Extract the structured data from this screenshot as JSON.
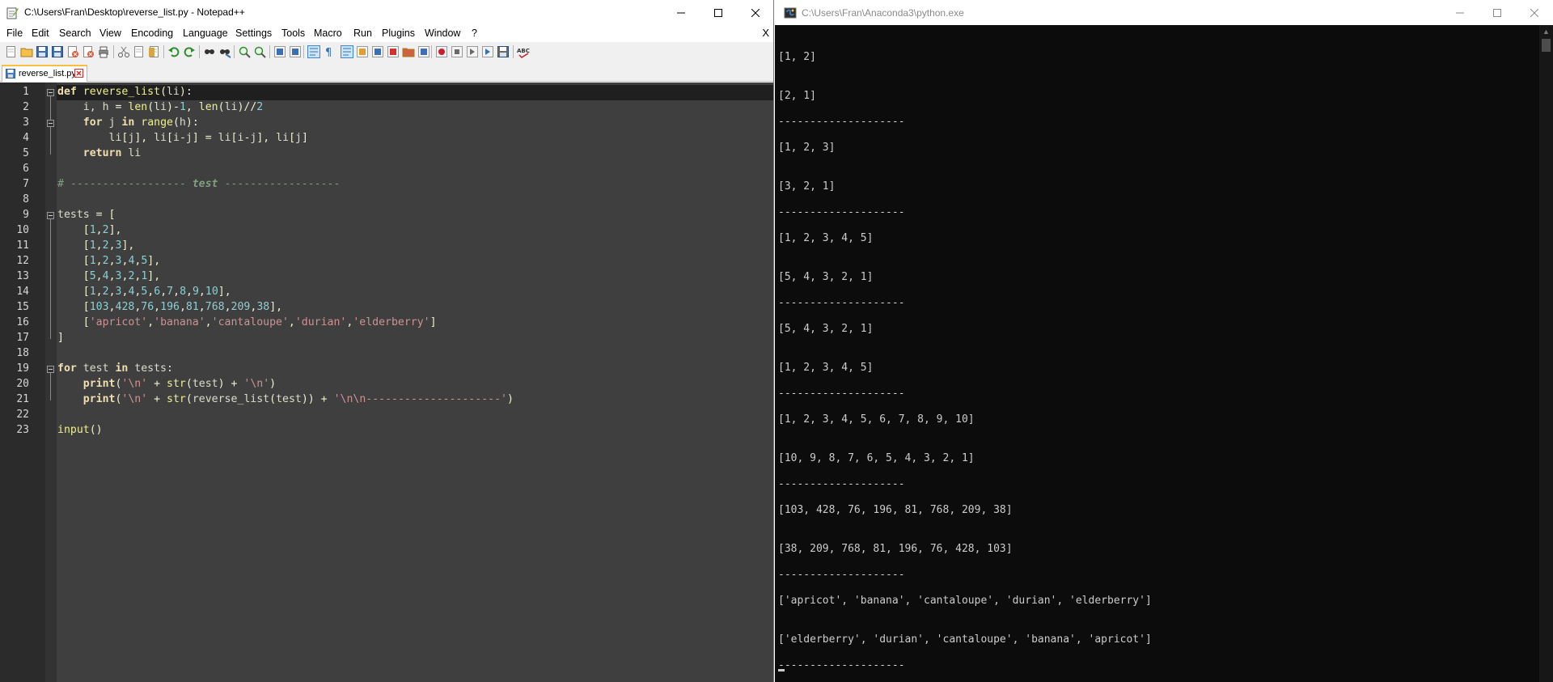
{
  "notepad": {
    "title": "C:\\Users\\Fran\\Desktop\\reverse_list.py - Notepad++",
    "menu": [
      "File",
      "Edit",
      "Search",
      "View",
      "Encoding",
      "Language",
      "Settings",
      "Tools",
      "Macro",
      "Run",
      "Plugins",
      "Window",
      "?"
    ],
    "doc_close_label": "X",
    "tab_label": "reverse_list.py",
    "line_numbers": [
      "1",
      "2",
      "3",
      "4",
      "5",
      "6",
      "7",
      "8",
      "9",
      "10",
      "11",
      "12",
      "13",
      "14",
      "15",
      "16",
      "17",
      "18",
      "19",
      "20",
      "21",
      "22",
      "23"
    ],
    "toolbar_icons": [
      "new-file-icon",
      "open-icon",
      "save-icon",
      "save-all-icon",
      "close-icon",
      "close-all-icon",
      "print-icon",
      "cut-icon",
      "copy-icon",
      "paste-icon",
      "undo-icon",
      "redo-icon",
      "find-icon",
      "replace-icon",
      "zoom-in-icon",
      "zoom-out-icon",
      "sync-vertical-icon",
      "sync-horizontal-icon",
      "word-wrap-icon",
      "show-all-chars-icon",
      "indent-guide-icon",
      "user-lang-icon",
      "doc-map-icon",
      "function-list-icon",
      "folder-workspace-icon",
      "monitoring-icon",
      "record-macro-icon",
      "stop-macro-icon",
      "play-macro-icon",
      "run-macro-multiple-icon",
      "save-macro-icon",
      "spell-check-icon"
    ]
  },
  "code": [
    [
      [
        "k",
        "def"
      ],
      [
        "p",
        " "
      ],
      [
        "f",
        "reverse_list"
      ],
      [
        "o",
        "("
      ],
      [
        "p",
        "li"
      ],
      [
        "o",
        "):"
      ]
    ],
    [
      [
        "p",
        "    i, h "
      ],
      [
        "o",
        "="
      ],
      [
        "p",
        " "
      ],
      [
        "f",
        "len"
      ],
      [
        "o",
        "("
      ],
      [
        "p",
        "li"
      ],
      [
        "o",
        ")-"
      ],
      [
        "n",
        "1"
      ],
      [
        "o",
        ","
      ],
      [
        "p",
        " "
      ],
      [
        "f",
        "len"
      ],
      [
        "o",
        "("
      ],
      [
        "p",
        "li"
      ],
      [
        "o",
        ")//"
      ],
      [
        "n",
        "2"
      ]
    ],
    [
      [
        "p",
        "    "
      ],
      [
        "k",
        "for"
      ],
      [
        "p",
        " j "
      ],
      [
        "k",
        "in"
      ],
      [
        "p",
        " "
      ],
      [
        "f",
        "range"
      ],
      [
        "o",
        "("
      ],
      [
        "p",
        "h"
      ],
      [
        "o",
        "):"
      ]
    ],
    [
      [
        "p",
        "        li"
      ],
      [
        "o",
        "["
      ],
      [
        "p",
        "j"
      ],
      [
        "o",
        "],"
      ],
      [
        "p",
        " li"
      ],
      [
        "o",
        "["
      ],
      [
        "p",
        "i"
      ],
      [
        "o",
        "-"
      ],
      [
        "p",
        "j"
      ],
      [
        "o",
        "]"
      ],
      [
        "p",
        " "
      ],
      [
        "o",
        "="
      ],
      [
        "p",
        " li"
      ],
      [
        "o",
        "["
      ],
      [
        "p",
        "i"
      ],
      [
        "o",
        "-"
      ],
      [
        "p",
        "j"
      ],
      [
        "o",
        "],"
      ],
      [
        "p",
        " li"
      ],
      [
        "o",
        "["
      ],
      [
        "p",
        "j"
      ],
      [
        "o",
        "]"
      ]
    ],
    [
      [
        "p",
        "    "
      ],
      [
        "k",
        "return"
      ],
      [
        "p",
        " li"
      ]
    ],
    [],
    [
      [
        "c",
        "# ------------------ "
      ],
      [
        "ci",
        "test"
      ],
      [
        "c",
        " ------------------"
      ]
    ],
    [],
    [
      [
        "p",
        "tests "
      ],
      [
        "o",
        "="
      ],
      [
        "p",
        " "
      ],
      [
        "o",
        "["
      ]
    ],
    [
      [
        "p",
        "    "
      ],
      [
        "o",
        "["
      ],
      [
        "n",
        "1"
      ],
      [
        "o",
        ","
      ],
      [
        "n",
        "2"
      ],
      [
        "o",
        "],"
      ]
    ],
    [
      [
        "p",
        "    "
      ],
      [
        "o",
        "["
      ],
      [
        "n",
        "1"
      ],
      [
        "o",
        ","
      ],
      [
        "n",
        "2"
      ],
      [
        "o",
        ","
      ],
      [
        "n",
        "3"
      ],
      [
        "o",
        "],"
      ]
    ],
    [
      [
        "p",
        "    "
      ],
      [
        "o",
        "["
      ],
      [
        "n",
        "1"
      ],
      [
        "o",
        ","
      ],
      [
        "n",
        "2"
      ],
      [
        "o",
        ","
      ],
      [
        "n",
        "3"
      ],
      [
        "o",
        ","
      ],
      [
        "n",
        "4"
      ],
      [
        "o",
        ","
      ],
      [
        "n",
        "5"
      ],
      [
        "o",
        "],"
      ]
    ],
    [
      [
        "p",
        "    "
      ],
      [
        "o",
        "["
      ],
      [
        "n",
        "5"
      ],
      [
        "o",
        ","
      ],
      [
        "n",
        "4"
      ],
      [
        "o",
        ","
      ],
      [
        "n",
        "3"
      ],
      [
        "o",
        ","
      ],
      [
        "n",
        "2"
      ],
      [
        "o",
        ","
      ],
      [
        "n",
        "1"
      ],
      [
        "o",
        "],"
      ]
    ],
    [
      [
        "p",
        "    "
      ],
      [
        "o",
        "["
      ],
      [
        "n",
        "1"
      ],
      [
        "o",
        ","
      ],
      [
        "n",
        "2"
      ],
      [
        "o",
        ","
      ],
      [
        "n",
        "3"
      ],
      [
        "o",
        ","
      ],
      [
        "n",
        "4"
      ],
      [
        "o",
        ","
      ],
      [
        "n",
        "5"
      ],
      [
        "o",
        ","
      ],
      [
        "n",
        "6"
      ],
      [
        "o",
        ","
      ],
      [
        "n",
        "7"
      ],
      [
        "o",
        ","
      ],
      [
        "n",
        "8"
      ],
      [
        "o",
        ","
      ],
      [
        "n",
        "9"
      ],
      [
        "o",
        ","
      ],
      [
        "n",
        "10"
      ],
      [
        "o",
        "],"
      ]
    ],
    [
      [
        "p",
        "    "
      ],
      [
        "o",
        "["
      ],
      [
        "n",
        "103"
      ],
      [
        "o",
        ","
      ],
      [
        "n",
        "428"
      ],
      [
        "o",
        ","
      ],
      [
        "n",
        "76"
      ],
      [
        "o",
        ","
      ],
      [
        "n",
        "196"
      ],
      [
        "o",
        ","
      ],
      [
        "n",
        "81"
      ],
      [
        "o",
        ","
      ],
      [
        "n",
        "768"
      ],
      [
        "o",
        ","
      ],
      [
        "n",
        "209"
      ],
      [
        "o",
        ","
      ],
      [
        "n",
        "38"
      ],
      [
        "o",
        "],"
      ]
    ],
    [
      [
        "p",
        "    "
      ],
      [
        "o",
        "["
      ],
      [
        "s",
        "'apricot'"
      ],
      [
        "o",
        ","
      ],
      [
        "s",
        "'banana'"
      ],
      [
        "o",
        ","
      ],
      [
        "s",
        "'cantaloupe'"
      ],
      [
        "o",
        ","
      ],
      [
        "s",
        "'durian'"
      ],
      [
        "o",
        ","
      ],
      [
        "s",
        "'elderberry'"
      ],
      [
        "o",
        "]"
      ]
    ],
    [
      [
        "o",
        "]"
      ]
    ],
    [],
    [
      [
        "k",
        "for"
      ],
      [
        "p",
        " test "
      ],
      [
        "k",
        "in"
      ],
      [
        "p",
        " tests"
      ],
      [
        "o",
        ":"
      ]
    ],
    [
      [
        "p",
        "    "
      ],
      [
        "k",
        "print"
      ],
      [
        "o",
        "("
      ],
      [
        "s",
        "'\\n'"
      ],
      [
        "p",
        " "
      ],
      [
        "o",
        "+"
      ],
      [
        "p",
        " "
      ],
      [
        "f",
        "str"
      ],
      [
        "o",
        "("
      ],
      [
        "p",
        "test"
      ],
      [
        "o",
        ")"
      ],
      [
        "p",
        " "
      ],
      [
        "o",
        "+"
      ],
      [
        "p",
        " "
      ],
      [
        "s",
        "'\\n'"
      ],
      [
        "o",
        ")"
      ]
    ],
    [
      [
        "p",
        "    "
      ],
      [
        "k",
        "print"
      ],
      [
        "o",
        "("
      ],
      [
        "s",
        "'\\n'"
      ],
      [
        "p",
        " "
      ],
      [
        "o",
        "+"
      ],
      [
        "p",
        " "
      ],
      [
        "f",
        "str"
      ],
      [
        "o",
        "("
      ],
      [
        "p",
        "reverse_list"
      ],
      [
        "o",
        "("
      ],
      [
        "p",
        "test"
      ],
      [
        "o",
        "))"
      ],
      [
        "p",
        " "
      ],
      [
        "o",
        "+"
      ],
      [
        "p",
        " "
      ],
      [
        "s",
        "'\\n\\n---------------------'"
      ],
      [
        "o",
        ")"
      ]
    ],
    [],
    [
      [
        "f",
        "input"
      ],
      [
        "o",
        "()"
      ]
    ]
  ],
  "console": {
    "title": "C:\\Users\\Fran\\Anaconda3\\python.exe",
    "lines": [
      "",
      "[1, 2]",
      "",
      "",
      "[2, 1]",
      "",
      "--------------------",
      "",
      "[1, 2, 3]",
      "",
      "",
      "[3, 2, 1]",
      "",
      "--------------------",
      "",
      "[1, 2, 3, 4, 5]",
      "",
      "",
      "[5, 4, 3, 2, 1]",
      "",
      "--------------------",
      "",
      "[5, 4, 3, 2, 1]",
      "",
      "",
      "[1, 2, 3, 4, 5]",
      "",
      "--------------------",
      "",
      "[1, 2, 3, 4, 5, 6, 7, 8, 9, 10]",
      "",
      "",
      "[10, 9, 8, 7, 6, 5, 4, 3, 2, 1]",
      "",
      "--------------------",
      "",
      "[103, 428, 76, 196, 81, 768, 209, 38]",
      "",
      "",
      "[38, 209, 768, 81, 196, 76, 428, 103]",
      "",
      "--------------------",
      "",
      "['apricot', 'banana', 'cantaloupe', 'durian', 'elderberry']",
      "",
      "",
      "['elderberry', 'durian', 'cantaloupe', 'banana', 'apricot']",
      "",
      "--------------------"
    ]
  },
  "colors": {
    "editor_bg": "#3f3f3f",
    "keyword": "#f0dfaf",
    "number": "#8cd0d3",
    "string": "#cc9393",
    "comment": "#7f9f7f",
    "console_bg": "#0c0c0c",
    "console_text": "#cccccc"
  }
}
